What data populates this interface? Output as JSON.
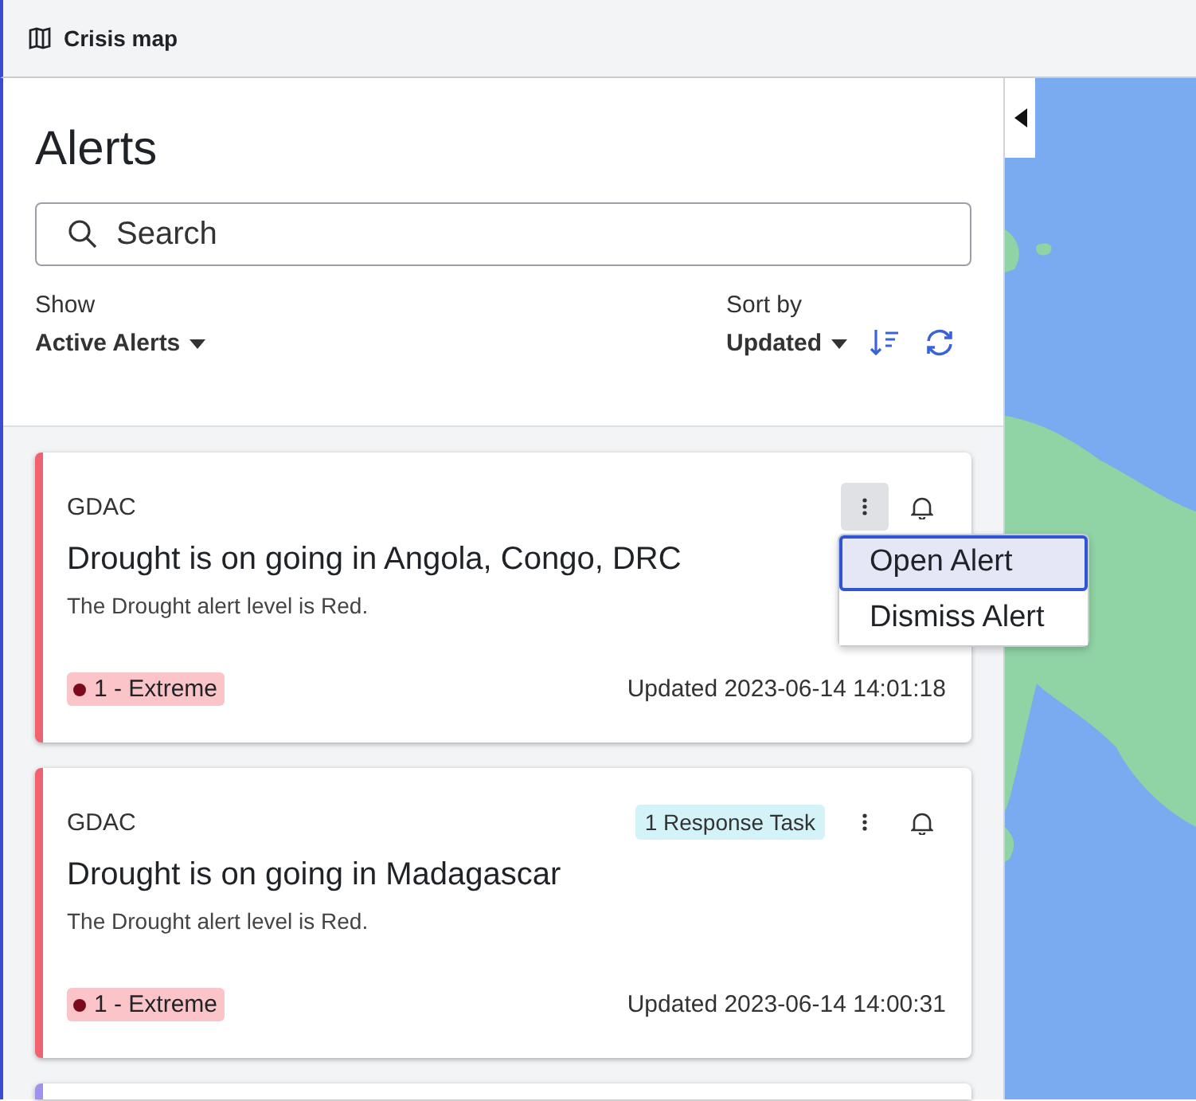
{
  "header": {
    "title": "Crisis map"
  },
  "panel": {
    "title": "Alerts",
    "search": {
      "placeholder": "Search"
    },
    "show": {
      "label": "Show",
      "value": "Active Alerts"
    },
    "sort": {
      "label": "Sort by",
      "value": "Updated"
    }
  },
  "alerts": [
    {
      "source": "GDAC",
      "title": "Drought is on going in Angola, Congo, DRC",
      "description": "The Drought alert level is Red.",
      "severity": "1 - Extreme",
      "updated": "Updated 2023-06-14 14:01:18",
      "color": "#f0626f",
      "menu_open": true,
      "menu": [
        {
          "label": "Open Alert",
          "selected": true
        },
        {
          "label": "Dismiss Alert",
          "selected": false
        }
      ]
    },
    {
      "source": "GDAC",
      "tasks": "1 Response Task",
      "title": "Drought is on going in Madagascar",
      "description": "The Drought alert level is Red.",
      "severity": "1 - Extreme",
      "updated": "Updated 2023-06-14 14:00:31",
      "color": "#f0626f",
      "menu_open": false
    },
    {
      "color": "#a090f0"
    }
  ]
}
